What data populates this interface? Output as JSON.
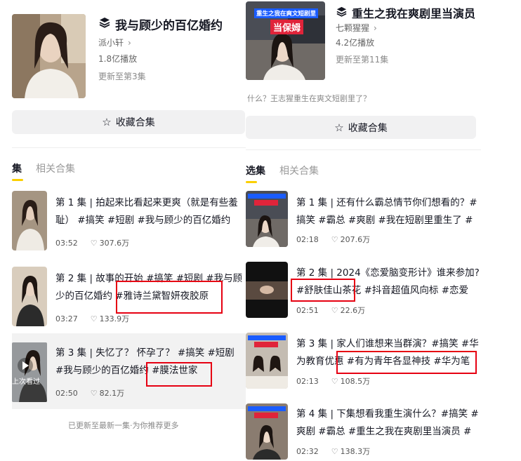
{
  "left": {
    "title": "我与顾少的百亿婚约",
    "author": "派小轩",
    "plays": "1.8亿播放",
    "update": "更新至第3集",
    "collect_label": "收藏合集",
    "tabs": [
      "集",
      "相关合集"
    ],
    "episodes": [
      {
        "text": "第 1 集 | 拍起来比看起来更爽（就是有些羞耻） #搞笑 #短剧 #我与顾少的百亿婚约",
        "time": "03:52",
        "likes": "307.6万"
      },
      {
        "text": "第 2 集 | 故事的开始 #搞笑 #短剧 #我与顾少的百亿婚约 #雅诗兰黛智妍夜胶原",
        "time": "03:27",
        "likes": "133.9万"
      },
      {
        "text": "第 3 集 | 失忆了？ 怀孕了？ #搞笑 #短剧 #我与顾少的百亿婚约 #膜法世家",
        "time": "02:50",
        "likes": "82.1万",
        "overlay": "上次看过"
      }
    ],
    "footer": "已更新至最新一集·为你推荐更多"
  },
  "right": {
    "title": "重生之我在爽剧里当演员",
    "author": "七颗猩猩",
    "plays": "4.2亿播放",
    "update": "更新至第11集",
    "desc": "什么？王志猩重生在爽文短剧里了？",
    "cover_text_top": "重生之我在爽文短剧里",
    "cover_text_big": "当保姆",
    "collect_label": "收藏合集",
    "tabs": [
      "选集",
      "相关合集"
    ],
    "episodes": [
      {
        "text": "第 1 集 | 还有什么霸总情节你们想看的？#搞笑 #霸总 #爽剧 #我在短剧里重生了 #重...",
        "time": "02:18",
        "likes": "207.6万"
      },
      {
        "text": "第 2 集 | 2024《恋爱脑变形计》谁来参加? #舒肤佳山茶花 #抖音超值风向标 #恋爱脑...",
        "time": "02:51",
        "likes": "22.6万"
      },
      {
        "text": "第 3 集 | 家人们谁想来当群演？#搞笑 #华为教育优惠 #有为青年各显神技 #华为笔记...",
        "time": "02:13",
        "likes": "108.5万"
      },
      {
        "text": "第 4 集 | 下集想看我重生演什么？#搞笑 #爽剧 #霸总 #重生之我在爽剧里当演员 #我...",
        "time": "02:32",
        "likes": "138.3万"
      }
    ]
  },
  "colors": {
    "accent": "#fbcf00",
    "highlight": "#e60012",
    "button_bg": "#f1f1f2"
  }
}
